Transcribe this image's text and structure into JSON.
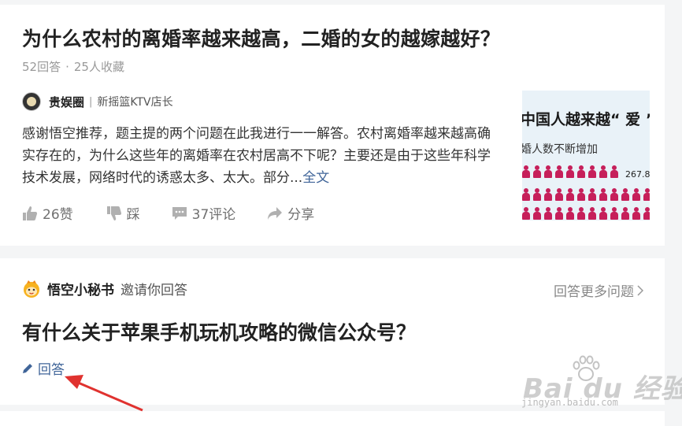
{
  "feed": {
    "card1": {
      "question_title": "为什么农村的离婚率越来越高，二婚的女的越嫁越好？",
      "answer_count": "52回答",
      "meta_dot": "·",
      "favorites": "25人收藏",
      "author": {
        "name": "贵娱圈",
        "separator": "|",
        "description": "新摇篮KTV店长"
      },
      "excerpt": "感谢悟空推荐，题主提的两个问题在此我进行一一解答。农村离婚率越来越高确实存在的，为什么这些年的离婚率在农村居高不下呢？主要还是由于这些年科学技术发展，网络时代的诱惑太多、太大。部分...",
      "more_link": "全文",
      "actions": {
        "like": "26赞",
        "dislike": "踩",
        "comments": "37评论",
        "share": "分享"
      },
      "thumbnail": {
        "title": "中国人越来越“ 爱 ”",
        "subtitle": "婚人数不断增加",
        "number": "267.8",
        "accent_color": "#c61f5a"
      }
    },
    "card2": {
      "inviter": "悟空小秘书",
      "invite_text": "邀请你回答",
      "answer_more": "回答更多问题",
      "question_title": "有什么关于苹果手机玩机攻略的微信公众号？",
      "answer_button": "回答"
    }
  },
  "watermark": {
    "text": "Bai du 经验",
    "sub": "jingyan.baidu.com"
  },
  "colors": {
    "link": "#406599",
    "arrow": "#e0322f",
    "background": "#f4f5f6"
  }
}
